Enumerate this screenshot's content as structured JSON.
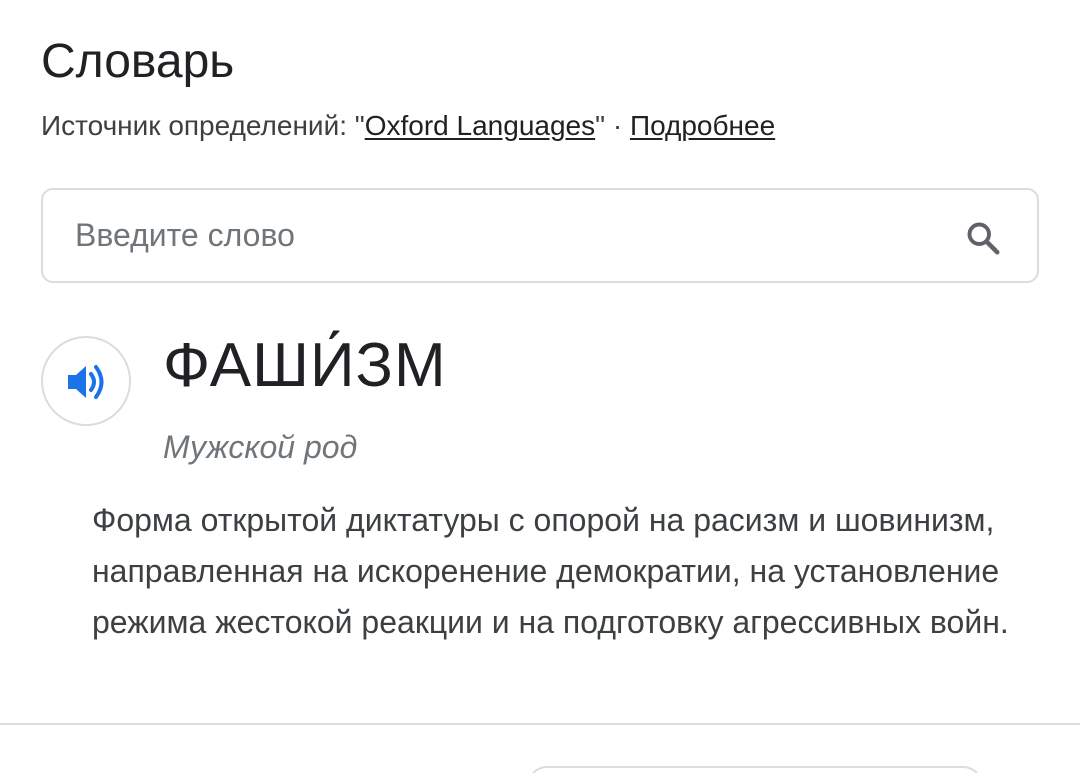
{
  "dictionary": {
    "title": "Словарь",
    "source_prefix": "Источник определений: \"",
    "source_name": "Oxford Languages",
    "source_suffix": "\" · ",
    "more_link": "Подробнее"
  },
  "search": {
    "placeholder": "Введите слово",
    "value": "",
    "icon": "search-icon"
  },
  "entry": {
    "word": "ФАШИ́ЗМ",
    "audio_icon": "speaker-icon",
    "gender": "Мужской род",
    "definition": "Форма открытой диктатуры с опорой на расизм и шовинизм, направленная на искоренение демократии, на установление режима жестокой реакции и на подготовку агрессивных войн."
  },
  "colors": {
    "accent_blue": "#1a73e8",
    "text_primary": "#202124",
    "text_secondary": "#70757a",
    "border": "#dadce0"
  }
}
